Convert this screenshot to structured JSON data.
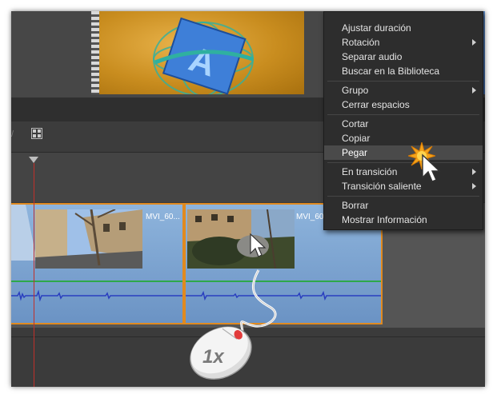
{
  "menu": {
    "items": [
      {
        "label": "Ajustar duración",
        "submenu": false
      },
      {
        "label": "Rotación",
        "submenu": true
      },
      {
        "label": "Separar audio",
        "submenu": false
      },
      {
        "label": "Buscar en la Biblioteca",
        "submenu": false
      },
      {
        "label": "Grupo",
        "submenu": true
      },
      {
        "label": "Cerrar espacios",
        "submenu": false
      },
      {
        "label": "Cortar",
        "submenu": false
      },
      {
        "label": "Copiar",
        "submenu": false
      },
      {
        "label": "Pegar",
        "submenu": false,
        "highlighted": true
      },
      {
        "label": "En transición",
        "submenu": true
      },
      {
        "label": "Transición saliente",
        "submenu": true
      },
      {
        "label": "Borrar",
        "submenu": false
      },
      {
        "label": "Mostrar Información",
        "submenu": false
      }
    ]
  },
  "clips": [
    {
      "name": "MVI_60..."
    },
    {
      "name": "MVI_60..."
    }
  ],
  "preview": {
    "letter": "A"
  },
  "mouse_hint": {
    "label": "1x"
  },
  "colors": {
    "clip_border": "#e08a20",
    "clip_fill": "#7aa3d2",
    "playhead": "#c0302a",
    "audio_wave": "#2a3fbf",
    "volume_line": "#2ea84a"
  },
  "icons": [
    "storyboard-toggle-icon",
    "playhead-marker-icon",
    "mouse-pointer-icon",
    "click-burst-icon",
    "mouse-icon"
  ]
}
